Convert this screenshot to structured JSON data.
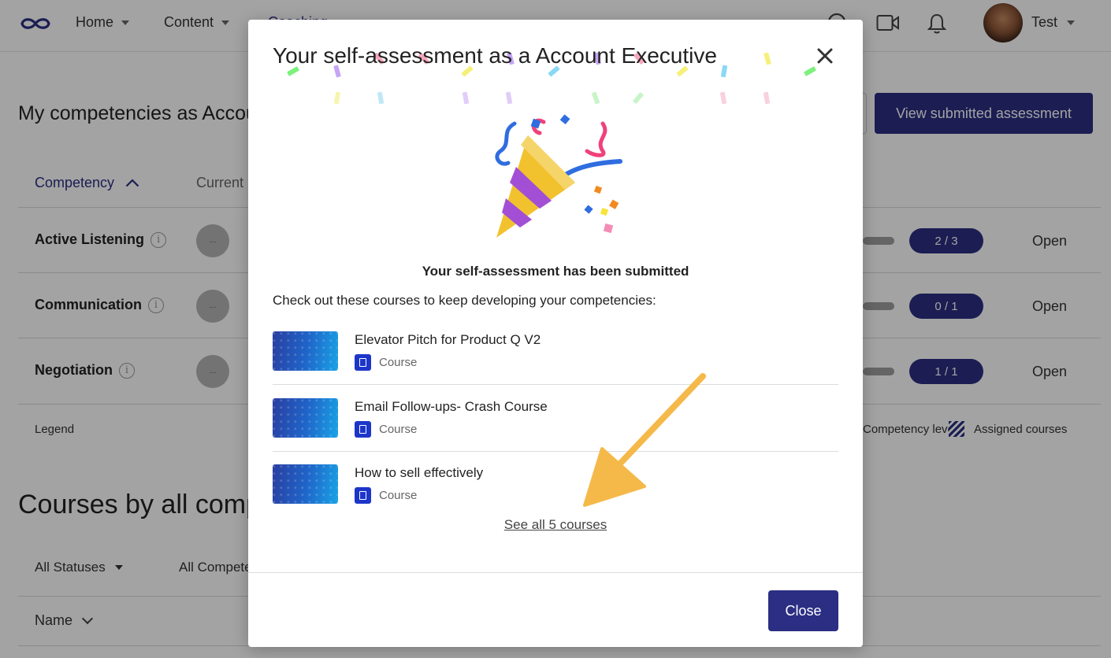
{
  "colors": {
    "primary": "#2b2e83",
    "course_icon": "#1d36c9",
    "arrow": "#f5b94a"
  },
  "nav": {
    "logo_icon": "infinity-logo-icon",
    "items": [
      {
        "label": "Home"
      },
      {
        "label": "Content"
      },
      {
        "label": "Coaching"
      }
    ],
    "user_name": "Test"
  },
  "page": {
    "title": "My competencies as Account Executive",
    "primary_button": "View submitted assessment",
    "table": {
      "header_competency": "Competency",
      "header_current": "Current",
      "rows": [
        {
          "name": "Active Listening",
          "level": "--",
          "count": "2 / 3",
          "action": "Open"
        },
        {
          "name": "Communication",
          "level": "--",
          "count": "0 / 1",
          "action": "Open"
        },
        {
          "name": "Negotiation",
          "level": "--",
          "count": "1 / 1",
          "action": "Open"
        }
      ]
    },
    "legend_label": "Legend",
    "legend_level": "Competency level",
    "legend_assigned": "Assigned courses",
    "courses_section_title": "Courses by all competencies",
    "filter_status": "All Statuses",
    "filter_competency": "All Competencies",
    "name_column": "Name"
  },
  "modal": {
    "title": "Your self-assessment as a Account Executive",
    "submitted_text": "Your self-assessment has been submitted",
    "checkout_text": "Check out these courses to keep developing your competencies:",
    "courses": [
      {
        "title": "Elevator Pitch for Product Q V2",
        "type": "Course"
      },
      {
        "title": "Email Follow-ups- Crash Course",
        "type": "Course"
      },
      {
        "title": "How to sell effectively",
        "type": "Course"
      }
    ],
    "see_all": "See all 5 courses",
    "close_button": "Close"
  }
}
